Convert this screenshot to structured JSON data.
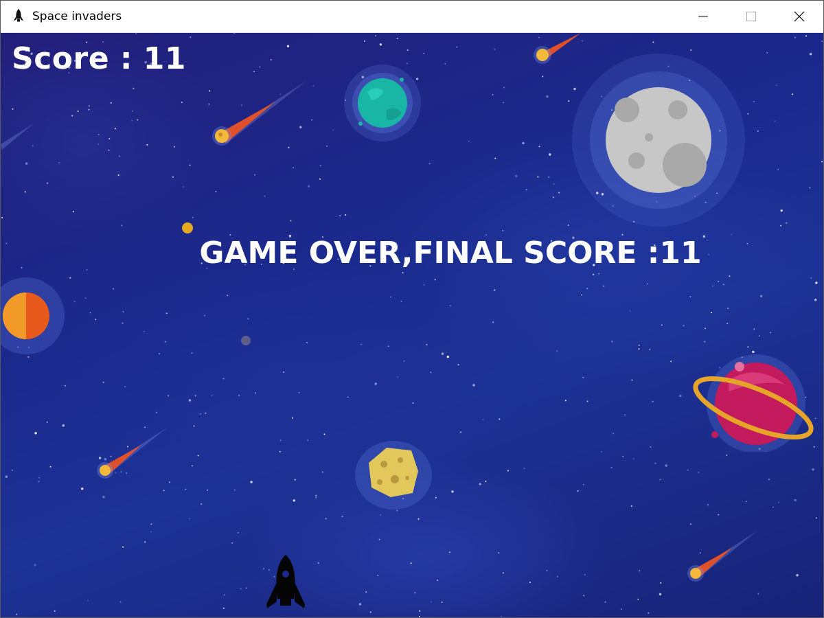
{
  "window": {
    "title": "Space invaders",
    "app_icon": "rocket-icon",
    "controls": [
      "minimize-icon",
      "maximize-icon",
      "close-icon"
    ]
  },
  "hud": {
    "score_text": "Score : 11",
    "score": 11
  },
  "message": {
    "game_over_text": "GAME OVER,FINAL SCORE :11"
  },
  "scene": {
    "player": "rocket-ship",
    "background_colors": [
      "#221f7a",
      "#1d3296"
    ],
    "decorations": [
      "comet",
      "teal-planet",
      "moon",
      "orange-planet",
      "ringed-planet",
      "asteroid"
    ]
  }
}
